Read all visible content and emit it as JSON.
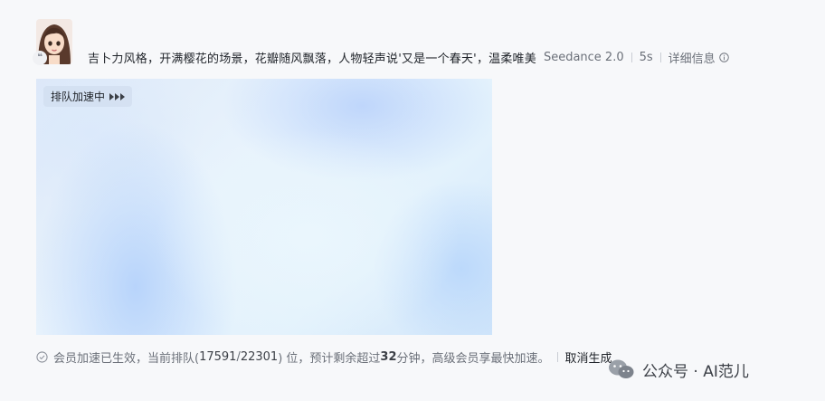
{
  "prompt": {
    "text": "吉卜力风格，开满樱花的场景，花瓣随风飘落，人物轻声说'又是一个春天'，温柔唯美",
    "model": "Seedance 2.0",
    "duration": "5s",
    "detail_link": "详细信息"
  },
  "video": {
    "queue_badge": "排队加速中"
  },
  "status": {
    "part1": "会员加速已生效，当前排队(",
    "position": "17591",
    "slash": "/",
    "total": "22301",
    "part2": ") 位，预计剩余超过 ",
    "minutes": "32",
    "part3": " 分钟，高级会员享最快加速。",
    "cancel_label": "取消生成"
  },
  "watermark": {
    "text": "公众号 · AI范儿"
  },
  "icons": {
    "avatar": "avatar-anime-girl",
    "quote": "quote-icon",
    "info": "info-icon",
    "check": "check-circle-icon",
    "play": "play-arrows-icon",
    "wechat": "wechat-logo-icon"
  }
}
